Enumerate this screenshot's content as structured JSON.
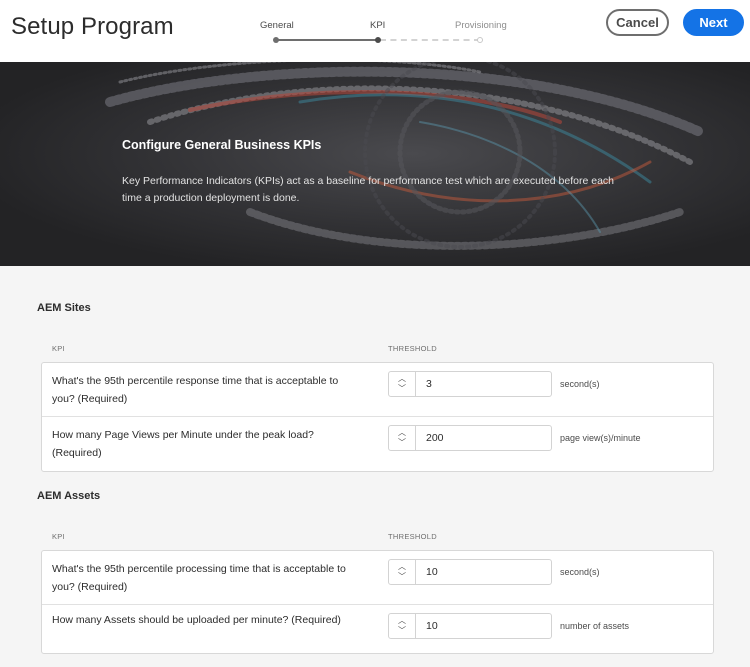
{
  "header": {
    "title": "Setup Program",
    "steps": [
      {
        "label": "General",
        "state": "done"
      },
      {
        "label": "KPI",
        "state": "current"
      },
      {
        "label": "Provisioning",
        "state": "upcoming"
      }
    ],
    "cancel_label": "Cancel",
    "next_label": "Next"
  },
  "banner": {
    "heading": "Configure General Business KPIs",
    "text": "Key Performance Indicators (KPIs) act as a baseline for performance test which are executed before each time a production deployment is done."
  },
  "sections": [
    {
      "title": "AEM Sites",
      "col_kpi": "KPI",
      "col_threshold": "THRESHOLD",
      "rows": [
        {
          "label": "What's the 95th percentile response time that is acceptable to you? (Required)",
          "value": "3",
          "unit": "second(s)"
        },
        {
          "label": "How many Page Views per Minute under the peak load? (Required)",
          "value": "200",
          "unit": "page view(s)/minute"
        }
      ]
    },
    {
      "title": "AEM Assets",
      "col_kpi": "KPI",
      "col_threshold": "THRESHOLD",
      "rows": [
        {
          "label": "What's the 95th percentile processing time that is acceptable to you? (Required)",
          "value": "10",
          "unit": "second(s)"
        },
        {
          "label": "How many Assets should be uploaded per minute? (Required)",
          "value": "10",
          "unit": "number of assets"
        }
      ]
    }
  ],
  "icons": {
    "spin_up": "chevron-up-icon",
    "spin_down": "chevron-down-icon"
  },
  "colors": {
    "accent": "#1473e6",
    "banner_bg": "#2a2a2c",
    "page_bg": "#f5f5f5"
  }
}
